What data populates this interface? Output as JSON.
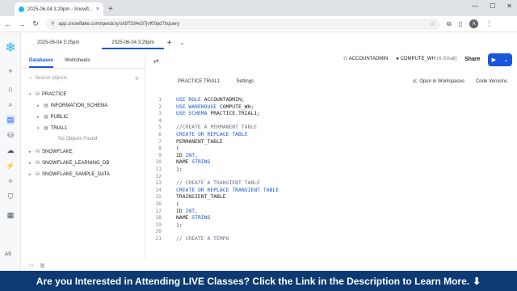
{
  "browser": {
    "tab_title": "2025-06-04 3:29pm - Snowfl...",
    "url": "app.snowflake.com/qeedcry/sk97334e37jvf00pd7t/query"
  },
  "worksheet_tabs": [
    {
      "label": "2025-06-04 3:25pm"
    },
    {
      "label": "2025-06-04 3:29pm"
    }
  ],
  "sidebar": {
    "tabs": [
      "Databases",
      "Worksheets"
    ],
    "search_placeholder": "Search objects",
    "tree": [
      {
        "label": "PRACTICE",
        "level": 0,
        "icon": "database-icon",
        "expanded": true
      },
      {
        "label": "INFORMATION_SCHEMA",
        "level": 1,
        "icon": "schema-icon"
      },
      {
        "label": "PUBLIC",
        "level": 1,
        "icon": "schema-icon"
      },
      {
        "label": "TRIAL1",
        "level": 1,
        "icon": "schema-icon",
        "expanded": true
      },
      {
        "label": "No Objects Found",
        "level": 2,
        "muted": true
      },
      {
        "label": "SNOWFLAKE",
        "level": 0,
        "icon": "database-icon"
      },
      {
        "label": "SNOWFLAKE_LEARNING_DB",
        "level": 0,
        "icon": "database-icon"
      },
      {
        "label": "SNOWFLAKE_SAMPLE_DATA",
        "level": 0,
        "icon": "database-icon"
      }
    ]
  },
  "toolbar": {
    "role": "ACCOUNTADMIN",
    "warehouse": "COMPUTE_WH",
    "warehouse_size": "(X-Small)",
    "share_label": "Share"
  },
  "subtoolbar": {
    "context": "PRACTICE.TRIAL1",
    "settings": "Settings",
    "open_workspaces": "Open in Workspaces",
    "code_versions": "Code Versions"
  },
  "editor": {
    "lines": [
      {
        "n": "1",
        "text": "USE ROLE ACCOUNTADMIN;"
      },
      {
        "n": "2",
        "text": "USE WAREHOUSE COMPUTE_WH;"
      },
      {
        "n": "3",
        "text": "USE SCHEMA PRACTICE.TRIAL1;"
      },
      {
        "n": "4",
        "text": ""
      },
      {
        "n": "5",
        "text": "//CREATE A PERMANENT TABLE"
      },
      {
        "n": "6",
        "text": "CREATE OR REPLACE TABLE"
      },
      {
        "n": "7",
        "text": "PERMANENT_TABLE"
      },
      {
        "n": "8",
        "text": "("
      },
      {
        "n": "9",
        "text": "ID INT,"
      },
      {
        "n": "10",
        "text": "NAME STRING"
      },
      {
        "n": "11",
        "text": ");"
      },
      {
        "n": "12",
        "text": ""
      },
      {
        "n": "13",
        "text": "// CREATE A TRANSIENT TABLE"
      },
      {
        "n": "14",
        "text": "CREATE OR REPLACE TRANSIENT TABLE"
      },
      {
        "n": "15",
        "text": "TRAINSIENT_TABLE"
      },
      {
        "n": "16",
        "text": "("
      },
      {
        "n": "17",
        "text": "ID INT,"
      },
      {
        "n": "18",
        "text": "NAME STRING"
      },
      {
        "n": "19",
        "text": ");"
      },
      {
        "n": "20",
        "text": ""
      },
      {
        "n": "21",
        "text": "// CREATE A TEMPO"
      }
    ]
  },
  "rail": {
    "user_initials": "AS"
  },
  "banner": {
    "text": "Are you Interested in Attending LIVE Classes? Click the Link in the Description to Learn More.",
    "arrow": "⬇"
  }
}
